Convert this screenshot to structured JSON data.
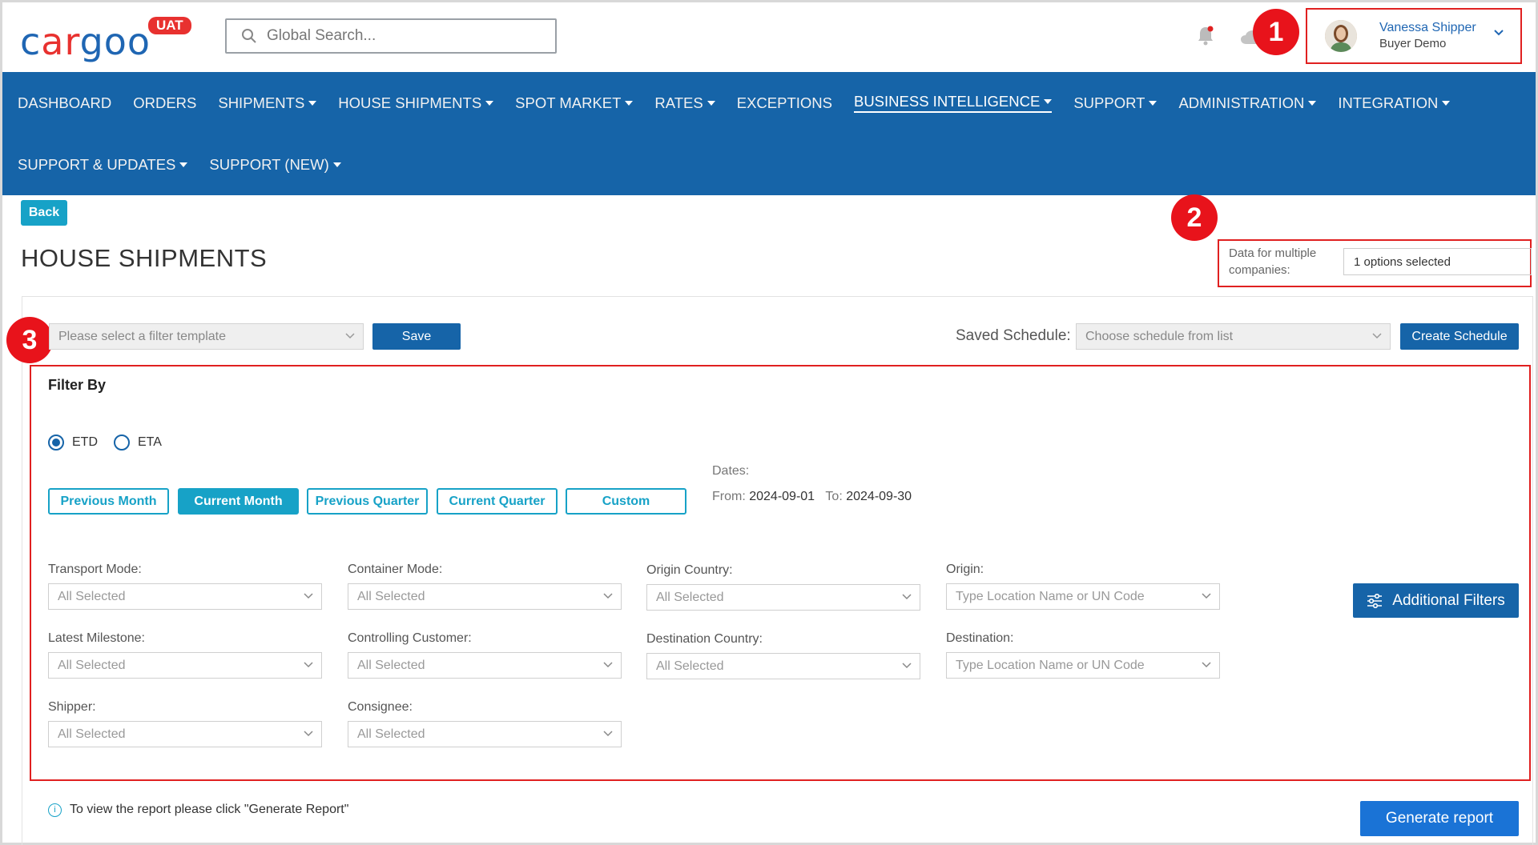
{
  "header": {
    "logo_prefix": "c",
    "logo_accent": "ar",
    "logo_suffix": "goo",
    "env_badge": "UAT",
    "search_placeholder": "Global Search...",
    "user_name": "Vanessa Shipper",
    "user_role": "Buyer Demo"
  },
  "annotations": [
    "1",
    "2",
    "3"
  ],
  "nav": {
    "row1": [
      "DASHBOARD",
      "ORDERS",
      "SHIPMENTS",
      "HOUSE SHIPMENTS",
      "SPOT MARKET",
      "RATES",
      "EXCEPTIONS",
      "BUSINESS INTELLIGENCE",
      "SUPPORT",
      "ADMINISTRATION",
      "INTEGRATION"
    ],
    "row2": [
      "SUPPORT & UPDATES",
      "SUPPORT (NEW)"
    ],
    "active": "BUSINESS INTELLIGENCE"
  },
  "page": {
    "back_label": "Back",
    "title": "HOUSE SHIPMENTS",
    "multi_company_label": "Data for multiple companies:",
    "multi_company_value": "1 options selected"
  },
  "toolbar": {
    "filter_template_placeholder": "Please select a filter template",
    "save_label": "Save",
    "saved_schedule_label": "Saved Schedule:",
    "schedule_placeholder": "Choose schedule from list",
    "create_schedule_label": "Create Schedule"
  },
  "filters": {
    "heading": "Filter By",
    "date_type_options": [
      "ETD",
      "ETA"
    ],
    "date_type_selected": "ETD",
    "period_buttons": [
      "Previous Month",
      "Current Month",
      "Previous Quarter",
      "Current Quarter",
      "Custom"
    ],
    "period_selected": "Current Month",
    "dates_label": "Dates:",
    "from_label": "From:",
    "from_value": "2024-09-01",
    "to_label": "To:",
    "to_value": "2024-09-30",
    "transport_mode": {
      "label": "Transport Mode:",
      "value": "All Selected"
    },
    "container_mode": {
      "label": "Container Mode:",
      "value": "All Selected"
    },
    "origin_country": {
      "label": "Origin Country:",
      "value": "All Selected"
    },
    "origin": {
      "label": "Origin:",
      "value": "Type Location Name or UN Code"
    },
    "latest_milestone": {
      "label": "Latest Milestone:",
      "value": "All Selected"
    },
    "controlling_customer": {
      "label": "Controlling Customer:",
      "value": "All Selected"
    },
    "destination_country": {
      "label": "Destination Country:",
      "value": "All Selected"
    },
    "destination": {
      "label": "Destination:",
      "value": "Type Location Name or UN Code"
    },
    "shipper": {
      "label": "Shipper:",
      "value": "All Selected"
    },
    "consignee": {
      "label": "Consignee:",
      "value": "All Selected"
    },
    "additional_filters_label": "Additional Filters"
  },
  "footer": {
    "info_text": "To view the report please click \"Generate Report\"",
    "generate_label": "Generate report"
  },
  "colors": {
    "brand_blue": "#1664a8",
    "accent_teal": "#17a2c7",
    "annotation_red": "#e8131b"
  }
}
